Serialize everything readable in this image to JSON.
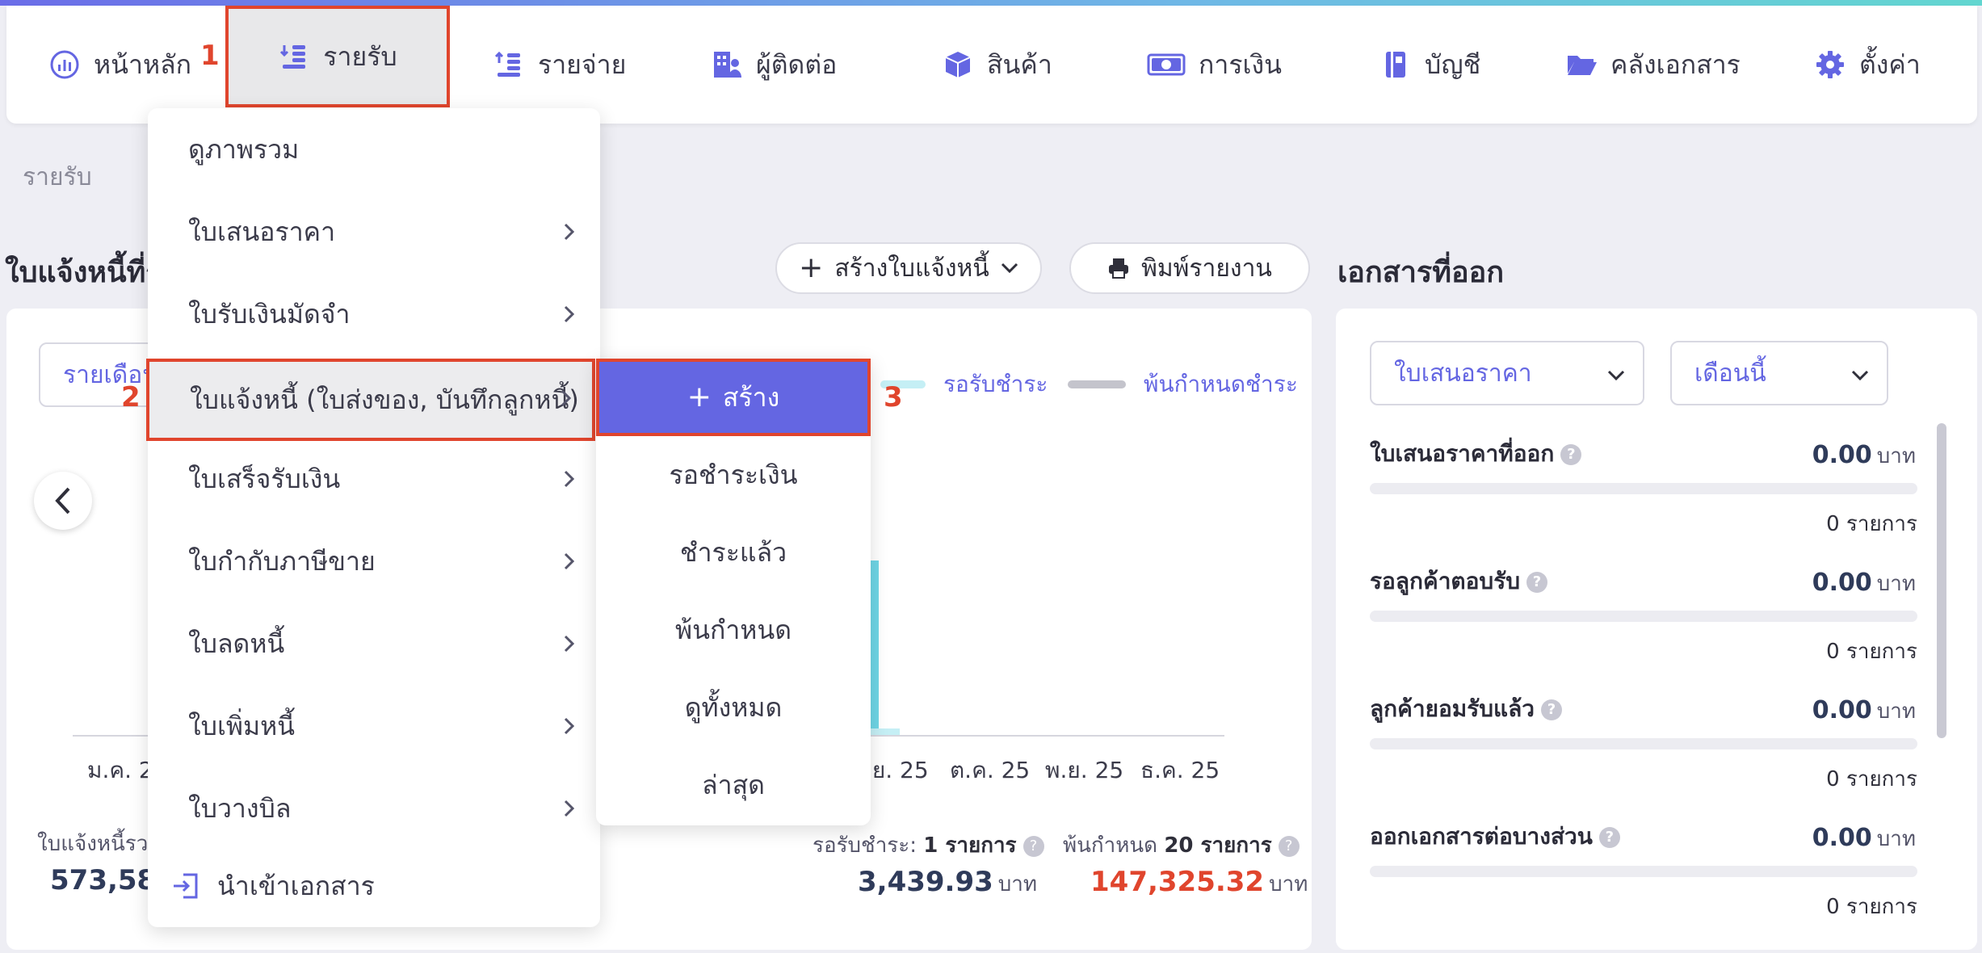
{
  "nav": {
    "items": [
      {
        "label": "หน้าหลัก",
        "icon": "dashboard-icon"
      },
      {
        "label": "รายรับ",
        "icon": "income-icon"
      },
      {
        "label": "รายจ่าย",
        "icon": "expense-icon"
      },
      {
        "label": "ผู้ติดต่อ",
        "icon": "contacts-icon"
      },
      {
        "label": "สินค้า",
        "icon": "box-icon"
      },
      {
        "label": "การเงิน",
        "icon": "money-icon"
      },
      {
        "label": "บัญชี",
        "icon": "ledger-icon"
      },
      {
        "label": "คลังเอกสาร",
        "icon": "folder-icon"
      },
      {
        "label": "ตั้งค่า",
        "icon": "gear-icon"
      }
    ]
  },
  "steps": {
    "one": "1",
    "two": "2",
    "three": "3"
  },
  "breadcrumb": "รายรับ",
  "page": {
    "heading": "ใบแจ้งหนี้ที่รั",
    "create_invoice_label": "สร้างใบแจ้งหนี้",
    "print_report_label": "พิมพ์รายงาน"
  },
  "main_card": {
    "period_select": "รายเดือน",
    "legend": {
      "pending": "รอรับชำระ",
      "overdue": "พ้นกำหนดชำระ"
    },
    "ticks": [
      "ม.ค. 25",
      "ก.ย. 25",
      "ต.ค. 25",
      "พ.ย. 25",
      "ธ.ค. 25"
    ],
    "total_label": "ใบแจ้งหนี้รวม",
    "total_value": "573,586",
    "pending_label": "รอรับชำระ",
    "pending_count": "1 รายการ",
    "pending_value": "3,439.93",
    "overdue_label": "พ้นกำหนด",
    "overdue_count": "20 รายการ",
    "overdue_value": "147,325.32",
    "unit": "บาท",
    "question": "?"
  },
  "docs": {
    "title": "เอกสารที่ออก",
    "doc_select": "ใบเสนอราคา",
    "month_select": "เดือนนี้",
    "unit": "บาท",
    "rows": [
      {
        "label": "ใบเสนอราคาที่ออก",
        "value": "0.00",
        "count": "0 รายการ"
      },
      {
        "label": "รอลูกค้าตอบรับ",
        "value": "0.00",
        "count": "0 รายการ"
      },
      {
        "label": "ลูกค้ายอมรับแล้ว",
        "value": "0.00",
        "count": "0 รายการ"
      },
      {
        "label": "ออกเอกสารต่อบางส่วน",
        "value": "0.00",
        "count": "0 รายการ"
      }
    ]
  },
  "menu": {
    "items": [
      "ดูภาพรวม",
      "ใบเสนอราคา",
      "ใบรับเงินมัดจำ",
      "ใบแจ้งหนี้ (ใบส่งของ, บันทึกลูกหนี้)",
      "ใบเสร็จรับเงิน",
      "ใบกำกับภาษีขาย",
      "ใบลดหนี้",
      "ใบเพิ่มหนี้",
      "ใบวางบิล"
    ],
    "import_label": "นำเข้าเอกสาร"
  },
  "submenu": {
    "create_label": "สร้าง",
    "items": [
      "รอชำระเงิน",
      "ชำระแล้ว",
      "พ้นกำหนด",
      "ดูทั้งหมด",
      "ล่าสุด"
    ]
  },
  "colors": {
    "accent": "#6466e2",
    "highlight": "#e0452d",
    "bar": "#6fd6e6",
    "overdue": "#e0452d"
  },
  "chart_data": {
    "type": "bar",
    "series": [
      {
        "name": "รอรับชำระ",
        "color": "#6fd6e6"
      },
      {
        "name": "พ้นกำหนดชำระ",
        "color": "#c4c4cc"
      }
    ]
  }
}
